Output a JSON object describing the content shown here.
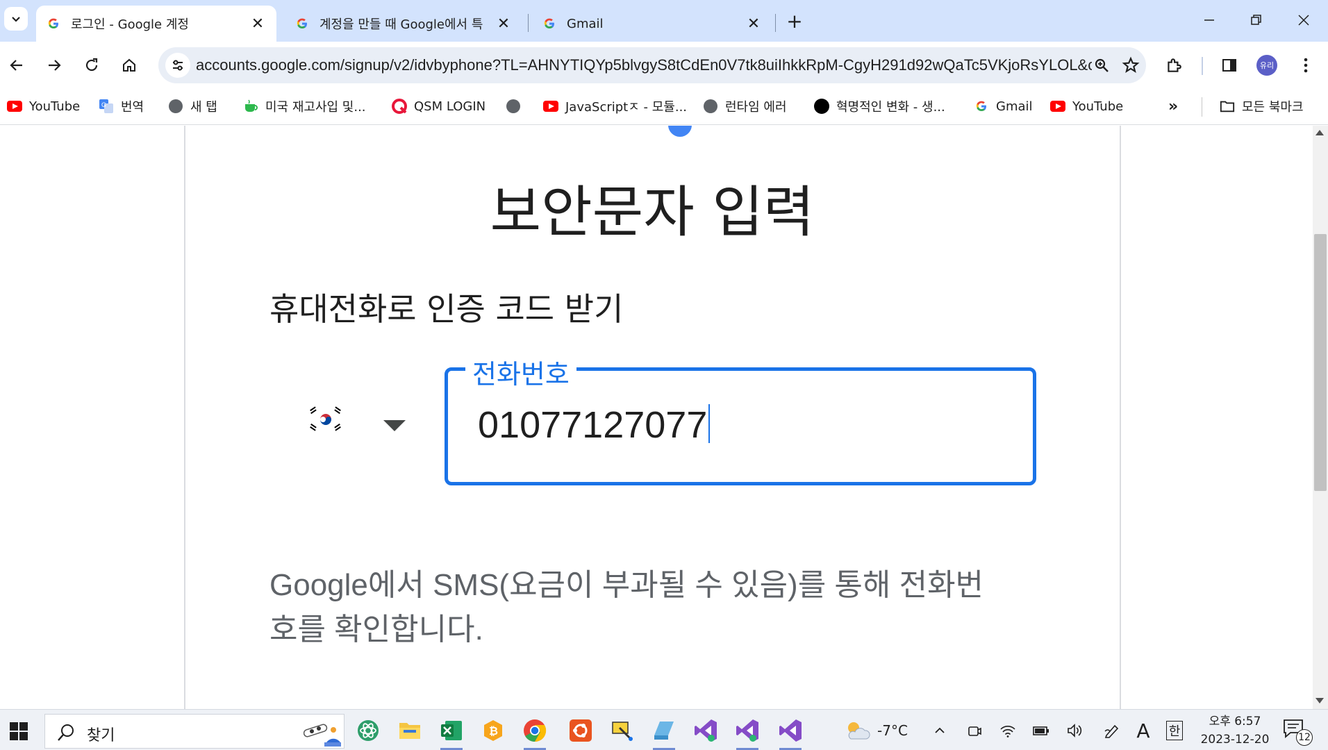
{
  "tabs": [
    {
      "title": "로그인 - Google 계정",
      "active": true
    },
    {
      "title": "계정을 만들 때 Google에서 특",
      "active": false
    },
    {
      "title": "Gmail",
      "active": false
    }
  ],
  "address_bar": {
    "url": "accounts.google.com/signup/v2/idvbyphone?TL=AHNYTIQYp5blvgyS8tCdEn0V7tk8uiIhkkRpM-CgyH291d92wQaTc5VKjoRsYLOL&co..."
  },
  "profile": {
    "label": "유리",
    "color": "#5b5fc7"
  },
  "bookmarks": [
    {
      "label": "YouTube",
      "icon": "youtube-icon"
    },
    {
      "label": "번역",
      "icon": "translate-icon"
    },
    {
      "label": "새 탭",
      "icon": "globe-icon"
    },
    {
      "label": "미국 재고사입 및...",
      "icon": "cup-icon"
    },
    {
      "label": "QSM LOGIN",
      "icon": "q-logo-icon"
    },
    {
      "label": "",
      "icon": "globe-icon"
    },
    {
      "label": "JavaScriptㅈ - 모듈...",
      "icon": "youtube-icon"
    },
    {
      "label": "런타임 에러",
      "icon": "globe-icon"
    },
    {
      "label": "혁명적인 변화 - 생...",
      "icon": "black-circle-icon"
    },
    {
      "label": "Gmail",
      "icon": "google-icon"
    },
    {
      "label": "YouTube",
      "icon": "youtube-icon"
    }
  ],
  "all_bookmarks_label": "모든 북마크",
  "page": {
    "heading": "보안문자 입력",
    "subheading": "휴대전화로 인증 코드 받기",
    "country": "대한민국",
    "phone_label": "전화번호",
    "phone_value": "01077127077",
    "info_line1": "Google에서 SMS(요금이 부과될 수 있음)를 통해 전화번",
    "info_line2": "호를 확인합니다."
  },
  "taskbar": {
    "search_placeholder": "찾기",
    "weather": "-7°C",
    "ime_letter": "A",
    "ime_lang": "한",
    "time": "오후 6:57",
    "date": "2023-12-20",
    "notification_count": "12"
  },
  "colors": {
    "accent": "#1a73e8",
    "tabstrip": "#d3e3fd",
    "omnibox": "#e9eef6"
  }
}
